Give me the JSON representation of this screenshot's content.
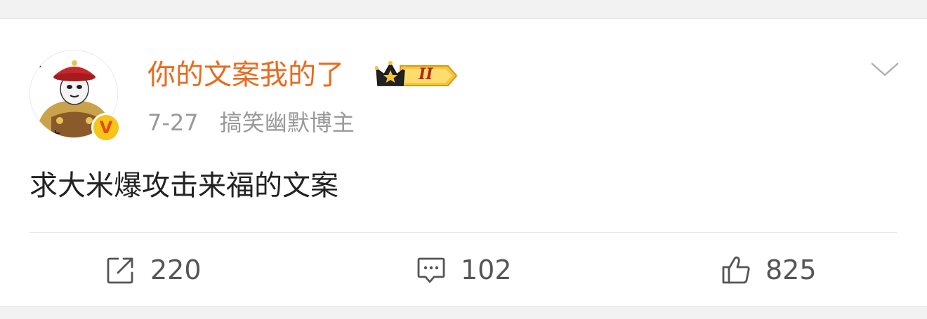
{
  "post": {
    "username": "你的文案我的了",
    "level_badge": "II",
    "date": "7-27",
    "tagline": "搞笑幽默博主",
    "content": "求大米爆攻击来福的文案",
    "verified_mark": "V"
  },
  "actions": {
    "repost_count": "220",
    "comment_count": "102",
    "like_count": "825"
  },
  "icons": {
    "repost": "share-out-icon",
    "comment": "comment-bubble-icon",
    "like": "thumbs-up-icon",
    "menu": "chevron-down-icon",
    "badge": "crown-icon"
  },
  "colors": {
    "username": "#e86b1e",
    "meta": "#999999",
    "content": "#222222",
    "action": "#555555",
    "background": "#f2f2f2"
  }
}
